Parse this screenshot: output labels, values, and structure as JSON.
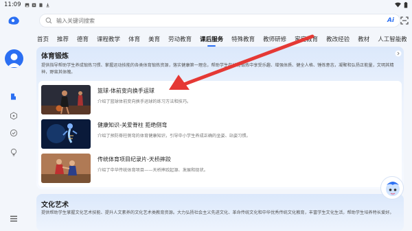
{
  "status_bar": {
    "time": "11:09"
  },
  "search": {
    "placeholder": "输入关键词搜索",
    "ai_label": "Ai"
  },
  "tabs": [
    "首页",
    "推荐",
    "德育",
    "课程教学",
    "体育",
    "美育",
    "劳动教育",
    "课后服务",
    "特殊教育",
    "教师研修",
    "家庭教育",
    "教改经验",
    "教材",
    "人工智能教"
  ],
  "active_tab_index": 7,
  "section1": {
    "title": "体育锻炼",
    "description": "提供指导帮助学生养成锻炼习惯、掌握运动技能的各类体育锻炼资源，落实健康第一理念，帮助学生在体育锻炼中享受乐趣、增强体质、健全人格、锤炼意志，凝聚和弘扬正能量，文明其精神，野蛮其体魄。",
    "items": [
      {
        "title": "篮球-体前变向换手运球",
        "desc": "介绍了篮球体前变向换手运球的练习方法和技巧。"
      },
      {
        "title": "健康知识-关爱脊柱 拒绝侧弯",
        "desc": "介绍了预防脊柱侧弯的体育健康知识，引导中小学生养成正确的坐姿、站姿习惯。"
      },
      {
        "title": "传统体育项目纪录片-天桥摔跤",
        "desc": "介绍了中华传统体育项目——天桥摔跤起源、发展和现状。"
      }
    ]
  },
  "section2": {
    "title": "文化艺术",
    "description": "提供帮助学生掌握文化艺术技能、提升人文素养的文化艺术类教育资源。大力弘扬社会主义先进文化、革命传统文化和中华优秀传统文化教育，丰富学生文化生活，帮助学生培养特长爱好。"
  },
  "colors": {
    "accent": "#2b6ff2",
    "arrow": "#e53935"
  }
}
